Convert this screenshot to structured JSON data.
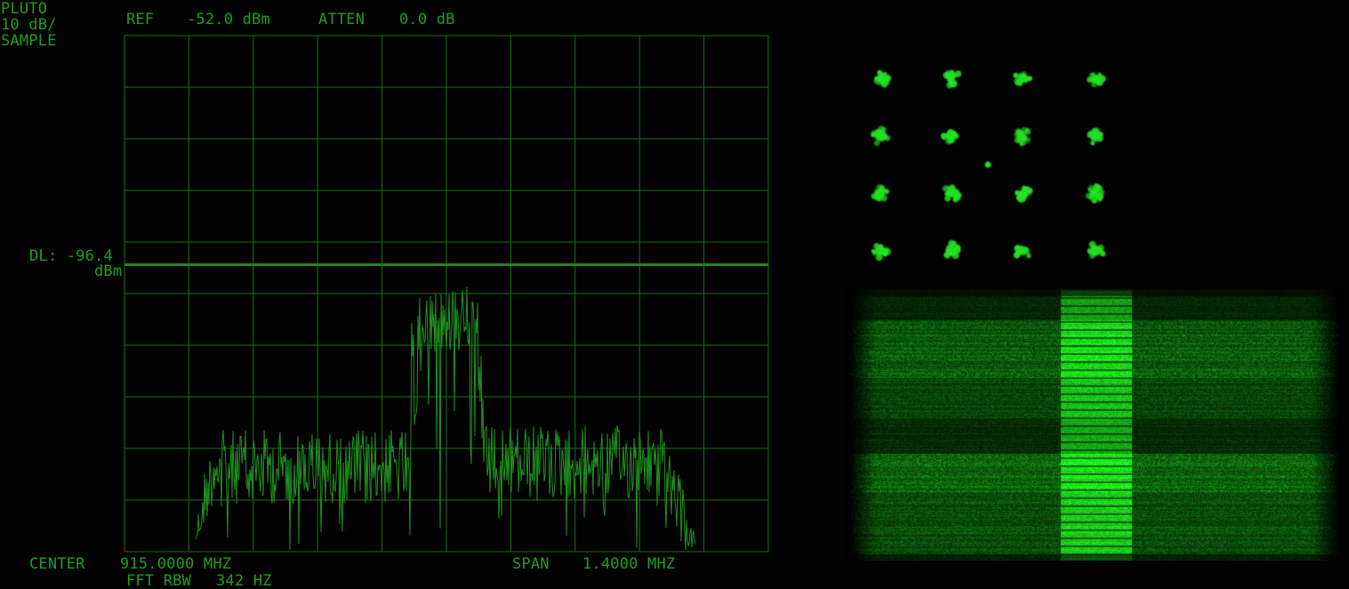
{
  "header": {
    "device": "PLUTO",
    "scale": "10 dB/",
    "mode": "SAMPLE",
    "ref_label": "REF",
    "ref_value": "-52.0 dBm",
    "atten_label": "ATTEN",
    "atten_value": "0.0 dB"
  },
  "display_line": {
    "label": "DL: -96.4",
    "unit": "dBm",
    "value_dbm": -96.4
  },
  "footer": {
    "center_label": "CENTER",
    "center_value": "915.0000 MHZ",
    "span_label": "SPAN",
    "span_value": "1.4000 MHZ",
    "rbw_label": "FFT RBW",
    "rbw_value": "342 HZ"
  },
  "spectrum": {
    "ref_level_dbm": -52.0,
    "db_per_div": 10,
    "vertical_divisions": 10,
    "horizontal_divisions": 10
  },
  "constellation": {
    "type": "16-QAM",
    "grid_size": 4
  },
  "colors": {
    "background": "#020202",
    "grid": "#1c6e1c",
    "trace": "#1f9a1f",
    "text": "#1e9e1e",
    "constellation_point": "#22e022",
    "waterfall_hot": "#28ff28"
  }
}
